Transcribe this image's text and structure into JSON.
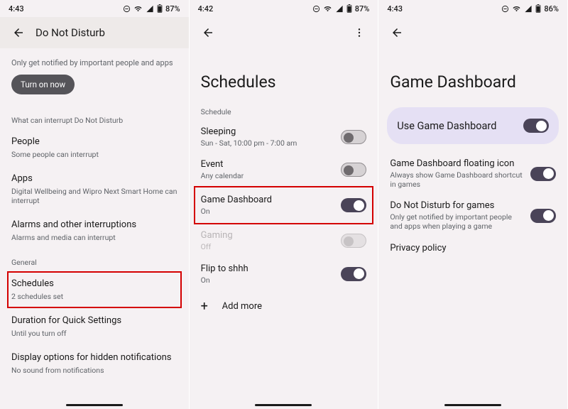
{
  "screen1": {
    "status": {
      "time": "4:43",
      "battery": "87%"
    },
    "title": "Do Not Disturb",
    "intro": "Only get notified by important people and apps",
    "turn_on": "Turn on now",
    "section_interrupt": "What can interrupt Do Not Disturb",
    "rows": {
      "people": {
        "title": "People",
        "sub": "Some people can interrupt"
      },
      "apps": {
        "title": "Apps",
        "sub": "Digital Wellbeing and Wipro Next Smart Home can interrupt"
      },
      "alarms": {
        "title": "Alarms and other interruptions",
        "sub": "Alarms and media can interrupt"
      }
    },
    "section_general": "General",
    "general": {
      "schedules": {
        "title": "Schedules",
        "sub": "2 schedules set"
      },
      "duration": {
        "title": "Duration for Quick Settings",
        "sub": "Until you turn off"
      },
      "display": {
        "title": "Display options for hidden notifications",
        "sub": "No sound from notifications"
      }
    }
  },
  "screen2": {
    "status": {
      "time": "4:42",
      "battery": "87%"
    },
    "headline": "Schedules",
    "section": "Schedule",
    "items": {
      "sleeping": {
        "title": "Sleeping",
        "sub": "Sun - Sat, 10:00 pm - 7:00 am",
        "on": false
      },
      "event": {
        "title": "Event",
        "sub": "Any calendar",
        "on": false
      },
      "game": {
        "title": "Game Dashboard",
        "sub": "On",
        "on": true
      },
      "gaming": {
        "title": "Gaming",
        "sub": "Off",
        "on": false,
        "disabled": true
      },
      "flip": {
        "title": "Flip to shhh",
        "sub": "On",
        "on": true
      }
    },
    "add_more": "Add more"
  },
  "screen3": {
    "status": {
      "time": "4:43",
      "battery": "86%"
    },
    "headline": "Game Dashboard",
    "hero": {
      "title": "Use Game Dashboard",
      "on": true
    },
    "items": {
      "floating": {
        "title": "Game Dashboard floating icon",
        "sub": "Always show Game Dashboard shortcut in games",
        "on": true
      },
      "dnd": {
        "title": "Do Not Disturb for games",
        "sub": "Only get notified by important people and apps when playing a game",
        "on": true
      },
      "privacy": {
        "title": "Privacy policy"
      }
    }
  }
}
